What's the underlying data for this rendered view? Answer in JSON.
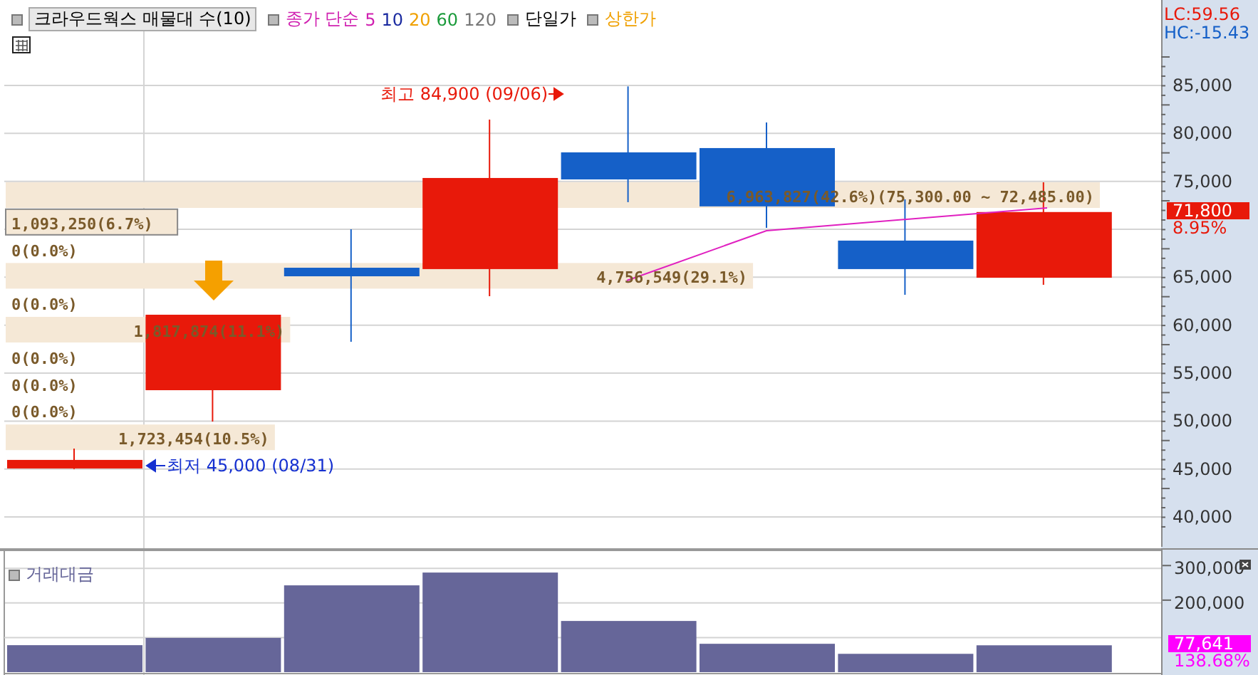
{
  "legend": {
    "title": "크라우드웍스 매물대 수(10)",
    "ma_label": "종가 단순",
    "ma_periods": [
      {
        "label": "5",
        "color": "#d020b0"
      },
      {
        "label": "10",
        "color": "#1a2aa0"
      },
      {
        "label": "20",
        "color": "#f0a000"
      },
      {
        "label": "60",
        "color": "#1a9a3a"
      },
      {
        "label": "120",
        "color": "#777777"
      }
    ],
    "indicators": [
      {
        "label": "단일가",
        "color": "#000000"
      },
      {
        "label": "상한가",
        "color": "#f0a000"
      }
    ]
  },
  "volume_profile": [
    {
      "label": "6,963,827(42.6%)(75,300.00 ~ 72,485.00)",
      "level": 1.0,
      "current": false
    },
    {
      "label": "1,093,250(6.7%)",
      "level": 0.157,
      "current": true
    },
    {
      "label": "0(0.0%)",
      "current": false
    },
    {
      "label": "4,756,549(29.1%)",
      "level": 0.683,
      "current": false
    },
    {
      "label": "0(0.0%)",
      "current": false
    },
    {
      "label": "1,817,874(11.1%)",
      "level": 0.26,
      "current": false
    },
    {
      "label": "0(0.0%)",
      "current": false
    },
    {
      "label": "0(0.0%)",
      "current": false
    },
    {
      "label": "0(0.0%)",
      "current": false
    },
    {
      "label": "1,723,454(10.5%)",
      "level": 0.246,
      "current": false
    }
  ],
  "high_marker": "최고 84,900 (09/06)",
  "low_marker": "최저 45,000 (08/31)",
  "price_axis": {
    "lc": "LC:59.56",
    "hc": "HC:-15.43",
    "ticks": [
      "85,000",
      "80,000",
      "75,000",
      "65,000",
      "60,000",
      "55,000",
      "50,000",
      "45,000",
      "40,000"
    ],
    "current_price": "71,800",
    "change": "8.95%"
  },
  "volume_panel": {
    "current_value": "77,641",
    "ratio": "138.68%",
    "chart_data": {
      "type": "bar",
      "title": "거래대금",
      "values": [
        78000,
        99000,
        251000,
        288000,
        148000,
        82000,
        53000,
        77641
      ],
      "ylim": [
        0,
        350000
      ],
      "yticks": [
        {
          "value": 200000,
          "label": "200,000"
        },
        {
          "value": 300000,
          "label": "300,000"
        }
      ]
    }
  }
}
